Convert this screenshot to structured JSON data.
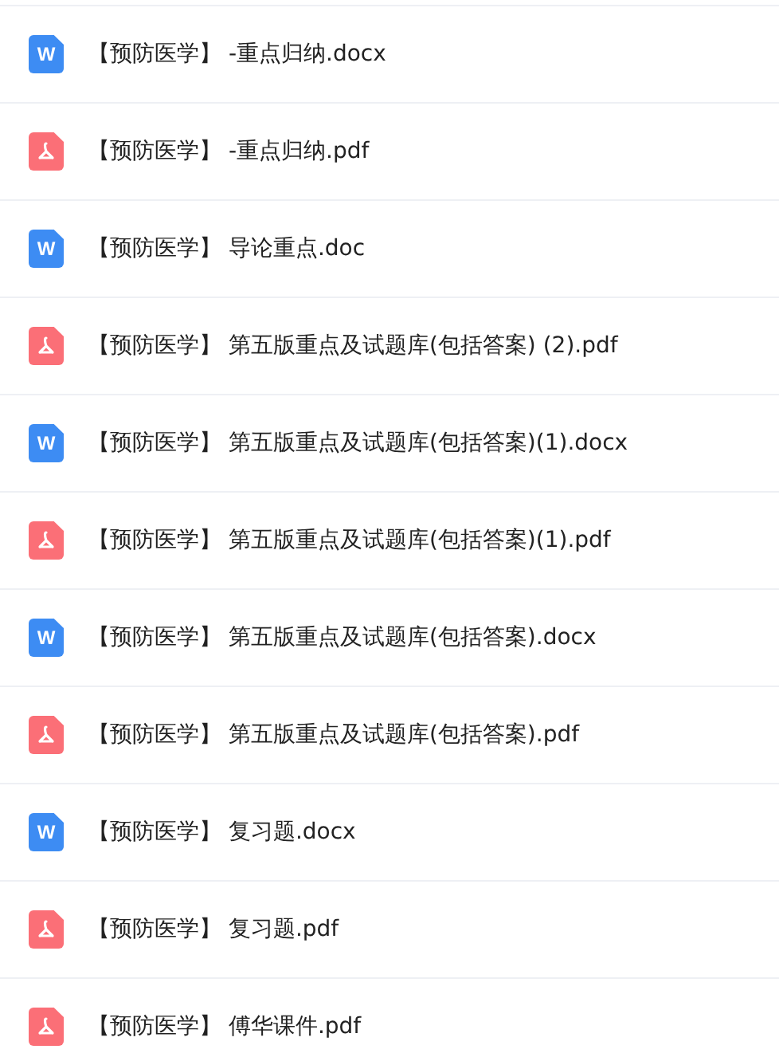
{
  "files": [
    {
      "kind": "word",
      "icon_text": "W",
      "name": "【预防医学】 -重点归纳.docx"
    },
    {
      "kind": "pdf",
      "name": "【预防医学】 -重点归纳.pdf"
    },
    {
      "kind": "word",
      "icon_text": "W",
      "name": "【预防医学】 导论重点.doc"
    },
    {
      "kind": "pdf",
      "name": "【预防医学】 第五版重点及试题库(包括答案) (2).pdf"
    },
    {
      "kind": "word",
      "icon_text": "W",
      "name": "【预防医学】 第五版重点及试题库(包括答案)(1).docx"
    },
    {
      "kind": "pdf",
      "name": "【预防医学】 第五版重点及试题库(包括答案)(1).pdf"
    },
    {
      "kind": "word",
      "icon_text": "W",
      "name": "【预防医学】 第五版重点及试题库(包括答案).docx"
    },
    {
      "kind": "pdf",
      "name": "【预防医学】 第五版重点及试题库(包括答案).pdf"
    },
    {
      "kind": "word",
      "icon_text": "W",
      "name": "【预防医学】 复习题.docx"
    },
    {
      "kind": "pdf",
      "name": "【预防医学】 复习题.pdf"
    },
    {
      "kind": "pdf",
      "name": "【预防医学】 傅华课件.pdf"
    }
  ]
}
